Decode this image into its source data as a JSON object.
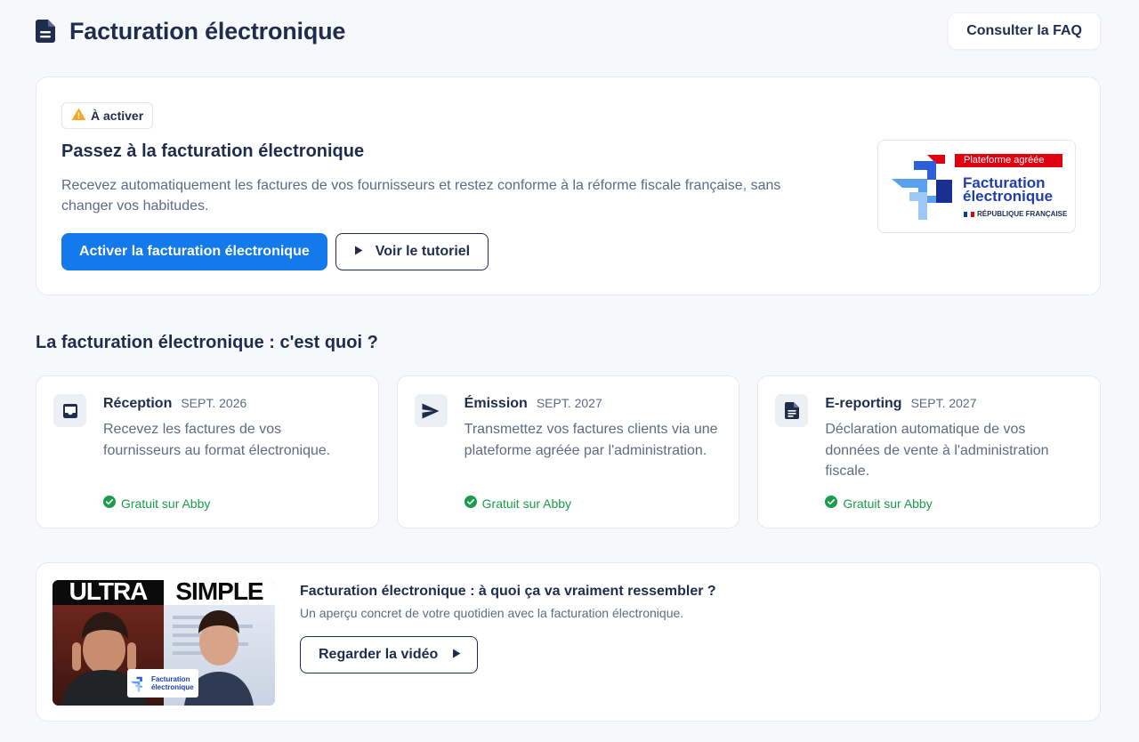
{
  "header": {
    "title": "Facturation électronique",
    "faq_label": "Consulter la FAQ"
  },
  "hero": {
    "badge": "À activer",
    "title": "Passez à la facturation électronique",
    "description": "Recevez automatiquement les factures de vos fournisseurs et restez conforme à la réforme fiscale française, sans changer vos habitudes.",
    "primary_cta": "Activer la facturation électronique",
    "secondary_cta": "Voir le tutoriel",
    "logo": {
      "ribbon": "Plateforme agréée",
      "line1": "Facturation",
      "line2": "électronique",
      "republic": "RÉPUBLIQUE FRANÇAISE"
    }
  },
  "section": {
    "title": "La facturation électronique : c'est quoi ?",
    "cards": [
      {
        "name": "Réception",
        "date": "SEPT. 2026",
        "description": "Recevez les factures de vos fournisseurs au format électronique.",
        "free": "Gratuit sur Abby",
        "icon": "inbox-icon"
      },
      {
        "name": "Émission",
        "date": "SEPT. 2027",
        "description": "Transmettez vos factures clients via une plateforme agréée par l'administration.",
        "free": "Gratuit sur Abby",
        "icon": "send-icon"
      },
      {
        "name": "E-reporting",
        "date": "SEPT. 2027",
        "description": "Déclaration automatique de vos données de vente à l'administration fiscale.",
        "free": "Gratuit sur Abby",
        "icon": "document-icon"
      }
    ]
  },
  "video": {
    "title": "Facturation électronique : à quoi ça va vraiment ressembler ?",
    "subtitle": "Un aperçu concret de votre quotidien avec la facturation électronique.",
    "button": "Regarder la vidéo",
    "thumb_word1": "ULTRA",
    "thumb_word2": "SIMPLE",
    "thumb_logo1": "Facturation",
    "thumb_logo2": "électronique"
  },
  "colors": {
    "primary": "#1479ea",
    "text": "#1f2d4d",
    "muted": "#5d6b85",
    "success": "#1a9c4b",
    "warning": "#f5a623"
  }
}
